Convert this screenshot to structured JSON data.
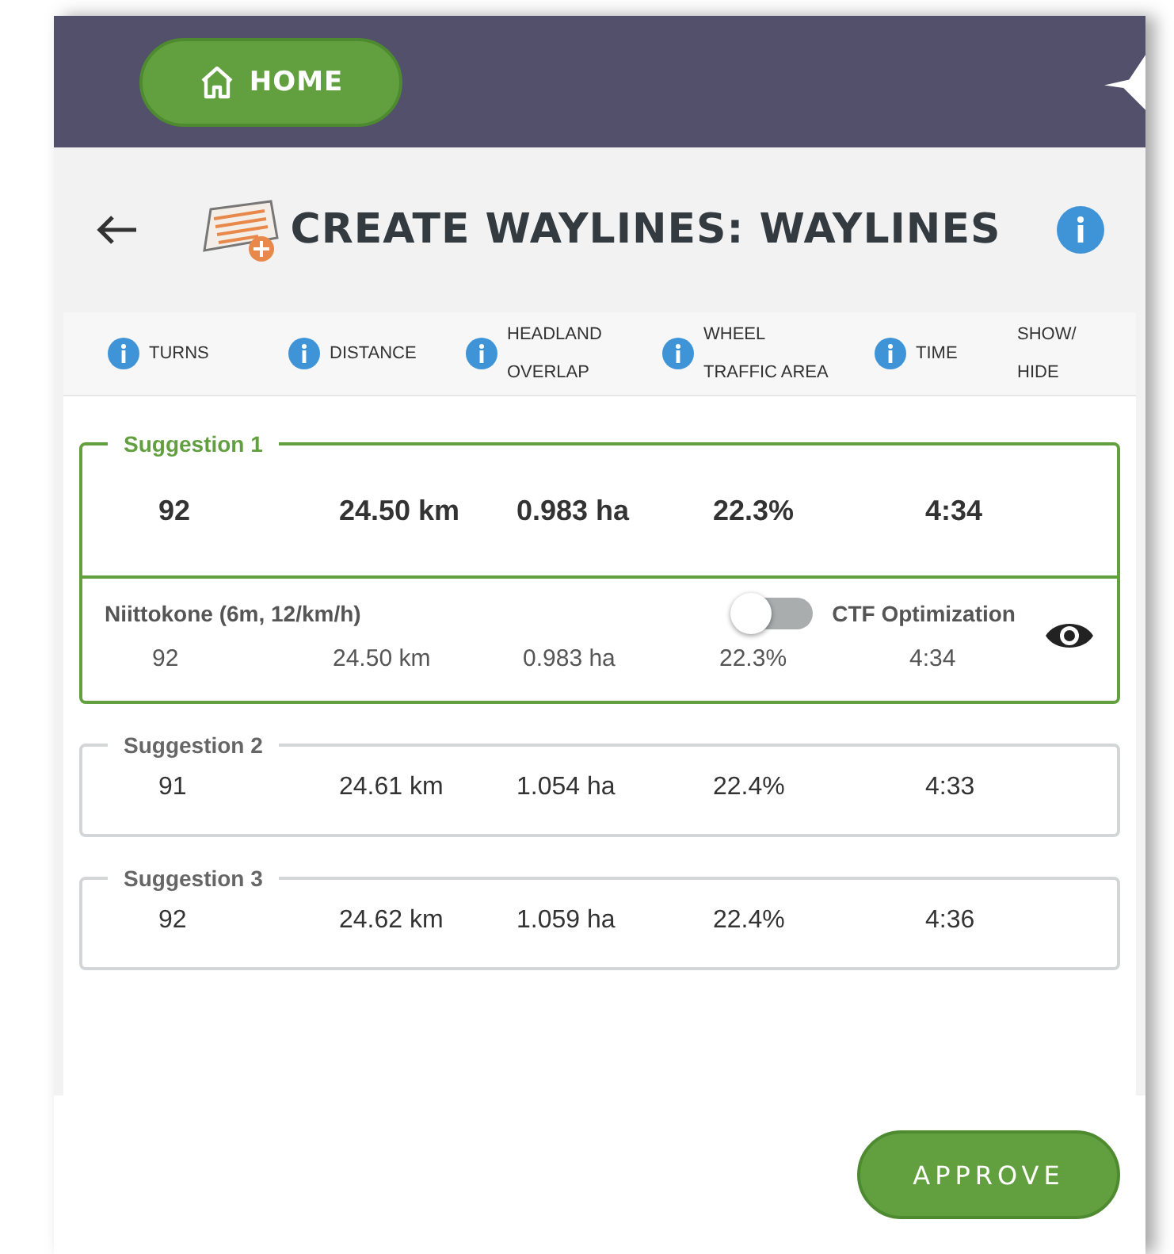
{
  "top_bar": {
    "home_button": "HOME"
  },
  "header": {
    "title": "CREATE WAYLINES: WAYLINES"
  },
  "table": {
    "columns": [
      {
        "label": "TURNS",
        "info": true
      },
      {
        "label": "DISTANCE",
        "info": true
      },
      {
        "label": "HEADLAND OVERLAP",
        "info": true
      },
      {
        "label": "WHEEL TRAFFIC AREA",
        "info": true
      },
      {
        "label": "TIME",
        "info": true
      },
      {
        "label": "SHOW/ HIDE",
        "info": false
      }
    ],
    "suggestions": [
      {
        "title": "Suggestion 1",
        "selected": true,
        "values": [
          "92",
          "24.50 km",
          "0.983 ha",
          "22.3%",
          "4:34"
        ],
        "machine": "Niittokone (6m, 12/km/h)",
        "ctf_label": "CTF Optimization",
        "ctf_on": false,
        "detail_values": [
          "92",
          "24.50 km",
          "0.983 ha",
          "22.3%",
          "4:34"
        ],
        "visible": true
      },
      {
        "title": "Suggestion 2",
        "selected": false,
        "values": [
          "91",
          "24.61 km",
          "1.054 ha",
          "22.4%",
          "4:33"
        ]
      },
      {
        "title": "Suggestion 3",
        "selected": false,
        "values": [
          "92",
          "24.62 km",
          "1.059 ha",
          "22.4%",
          "4:36"
        ]
      }
    ]
  },
  "footer": {
    "approve_button": "APPROVE"
  }
}
